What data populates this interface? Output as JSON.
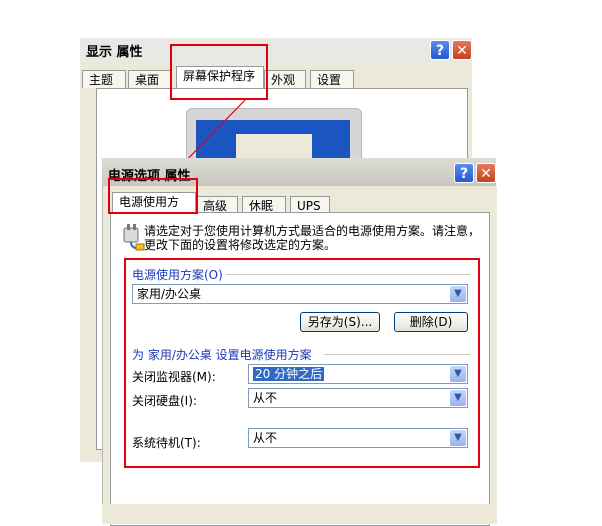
{
  "back_window": {
    "title": "显示 属性",
    "tabs": [
      "主题",
      "桌面",
      "屏幕保护程序",
      "外观",
      "设置"
    ],
    "help_label": "?",
    "close_label": "✕"
  },
  "front_window": {
    "title": "电源选项 属性",
    "help_label": "?",
    "close_label": "✕",
    "tabs": [
      "电源使用方案",
      "高级",
      "休眠",
      "UPS"
    ],
    "description": "请选定对于您使用计算机方式最适合的电源使用方案。请注意，更改下面的设置将修改选定的方案。",
    "scheme_group_label": "电源使用方案(O)",
    "scheme_value": "家用/办公桌",
    "save_as_label": "另存为(S)...",
    "delete_label": "删除(D)",
    "settings_group_label": "为 家用/办公桌 设置电源使用方案",
    "fields": [
      {
        "label": "关闭监视器(M):",
        "value": "20 分钟之后"
      },
      {
        "label": "关闭硬盘(I):",
        "value": "从不"
      },
      {
        "label": "系统待机(T):",
        "value": "从不"
      }
    ]
  },
  "colors": {
    "highlight": "#e0000f",
    "accent_blue": "#316ac5",
    "window_bg": "#ece9d8"
  },
  "icons": {
    "dropdown": "chevron-down-icon",
    "power": "power-plug-icon"
  }
}
